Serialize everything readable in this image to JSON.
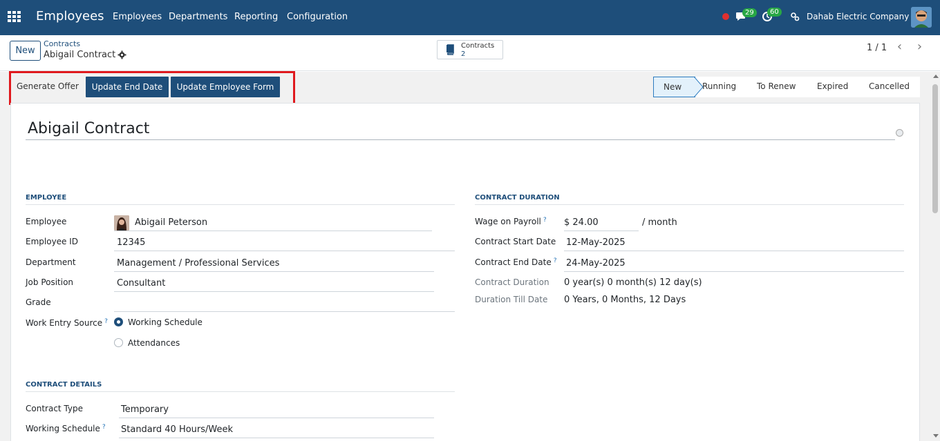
{
  "topnav": {
    "app_title": "Employees",
    "menu": [
      "Employees",
      "Departments",
      "Reporting",
      "Configuration"
    ],
    "messages_count": "29",
    "activities_count": "60",
    "company": "Dahab Electric Company",
    "color": "#1e4e7a"
  },
  "control": {
    "new_label": "New",
    "breadcrumb_parent": "Contracts",
    "breadcrumb_current": "Abigail Contract",
    "smart_button": {
      "label": "Contracts",
      "value": "2"
    },
    "pager": "1 / 1"
  },
  "actions": {
    "generate_offer": "Generate Offer",
    "update_end_date": "Update End Date",
    "update_employee_form": "Update Employee Form"
  },
  "stages": {
    "items": [
      "New",
      "Running",
      "To Renew",
      "Expired",
      "Cancelled"
    ],
    "active": "New"
  },
  "form": {
    "title": "Abigail Contract",
    "employee_section": {
      "title": "EMPLOYEE",
      "employee_label": "Employee",
      "employee_value": "Abigail Peterson",
      "employee_id_label": "Employee ID",
      "employee_id_value": "12345",
      "department_label": "Department",
      "department_value": "Management / Professional Services",
      "job_label": "Job Position",
      "job_value": "Consultant",
      "grade_label": "Grade",
      "grade_value": "",
      "work_entry_label": "Work Entry Source",
      "work_entry_options": [
        "Working Schedule",
        "Attendances"
      ],
      "work_entry_selected": "Working Schedule"
    },
    "duration_section": {
      "title": "CONTRACT DURATION",
      "wage_label": "Wage on Payroll",
      "wage_value": "$ 24.00",
      "wage_unit": "/ month",
      "start_label": "Contract Start Date",
      "start_value": "12-May-2025",
      "end_label": "Contract End Date",
      "end_value": "24-May-2025",
      "duration_label": "Contract Duration",
      "duration_value": "0 year(s) 0 month(s) 12 day(s)",
      "till_label": "Duration Till Date",
      "till_value": "0 Years, 0 Months, 12 Days"
    },
    "details_section": {
      "title": "CONTRACT DETAILS",
      "type_label": "Contract Type",
      "type_value": "Temporary",
      "schedule_label": "Working Schedule",
      "schedule_value": "Standard 40 Hours/Week"
    }
  }
}
